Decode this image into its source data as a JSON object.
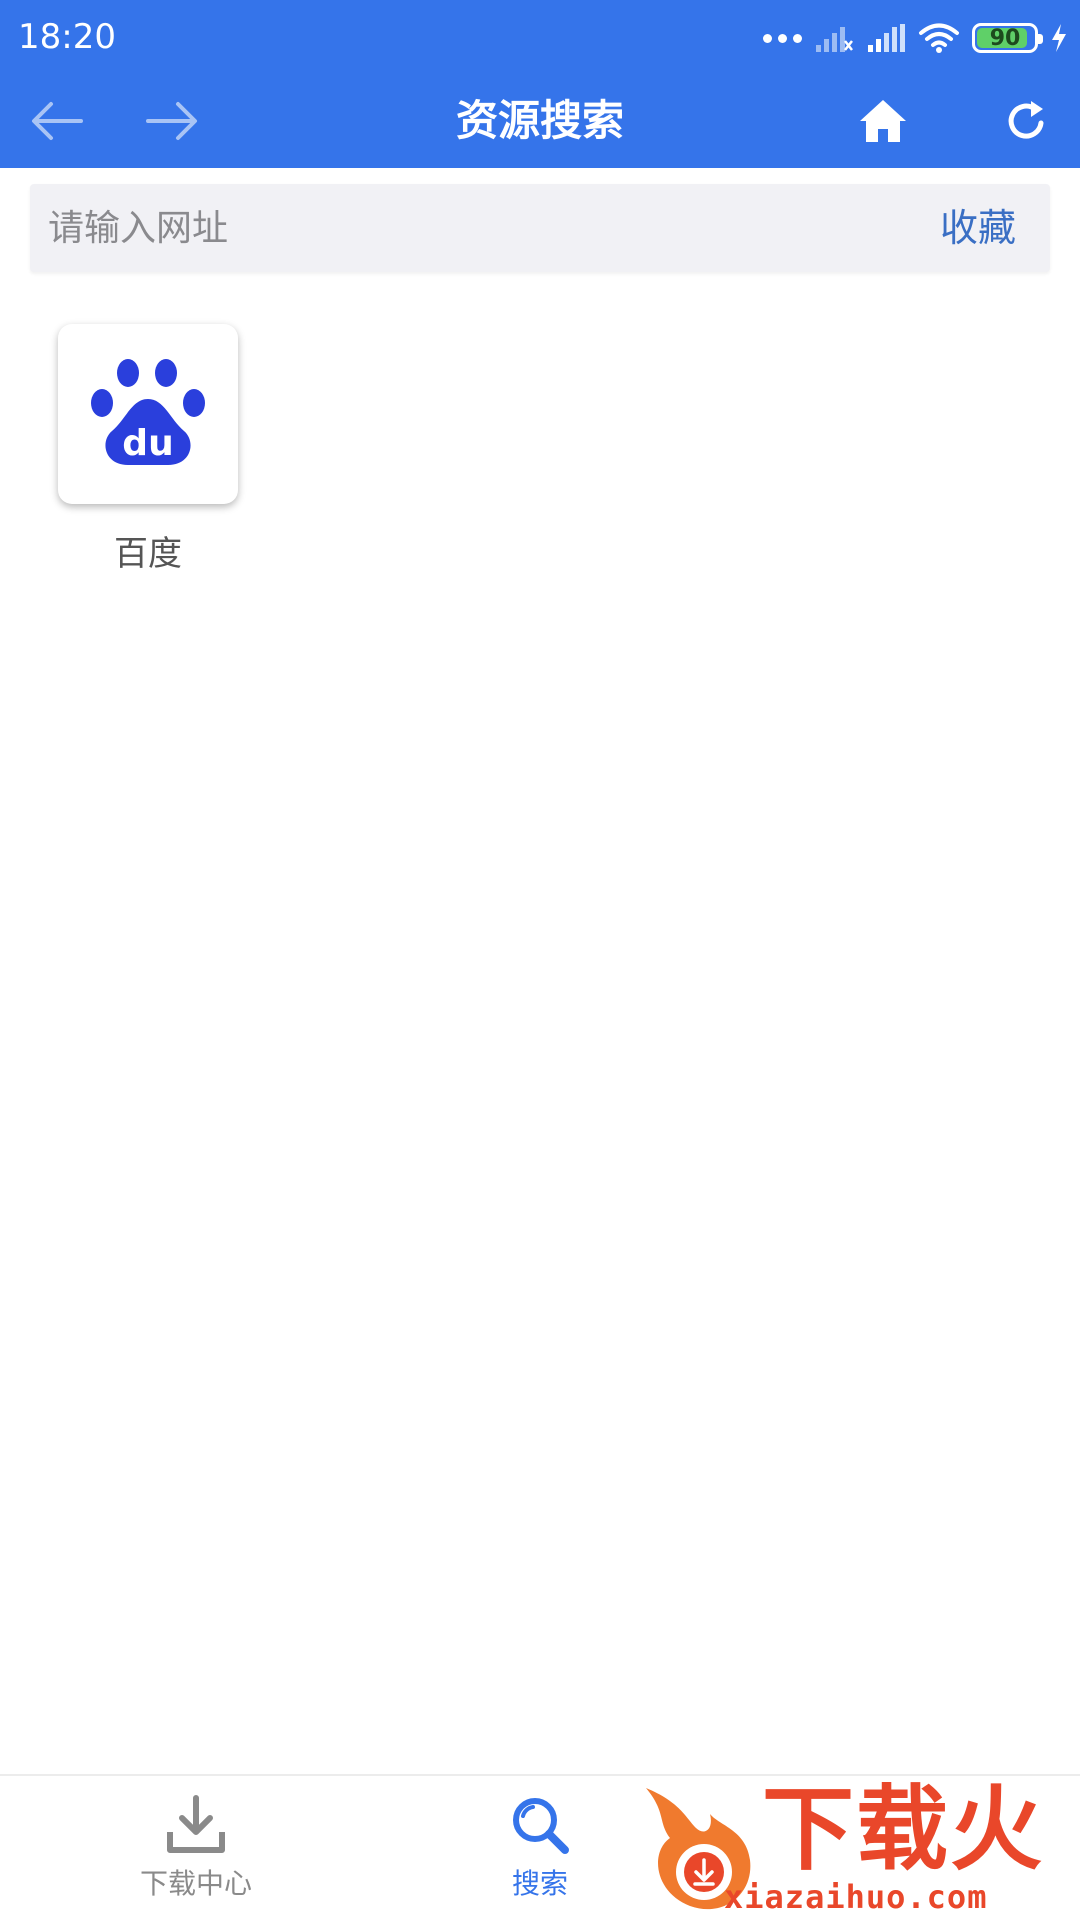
{
  "status_bar": {
    "time": "18:20",
    "battery": "90",
    "battery_level": 0.9
  },
  "nav": {
    "title": "资源搜索",
    "back_icon": "arrow-left-icon",
    "forward_icon": "arrow-right-icon",
    "home_icon": "home-icon",
    "refresh_icon": "refresh-icon"
  },
  "search": {
    "placeholder": "请输入网址",
    "value": "",
    "favorite_label": "收藏"
  },
  "bookmarks": [
    {
      "label": "百度",
      "icon": "baidu-paw-icon",
      "icon_text": "du"
    }
  ],
  "tabs": [
    {
      "label": "下载中心",
      "icon": "download-icon",
      "active": false
    },
    {
      "label": "搜索",
      "icon": "search-icon",
      "active": true
    }
  ],
  "watermark": {
    "text": "下载火",
    "url": "xiazaihuo.com"
  },
  "colors": {
    "primary": "#3574ea",
    "accent_text": "#3a6fc4",
    "inactive_tab": "#8a8a8a",
    "baidu_blue": "#2a3fdc",
    "watermark_orange": "#e9472a"
  }
}
